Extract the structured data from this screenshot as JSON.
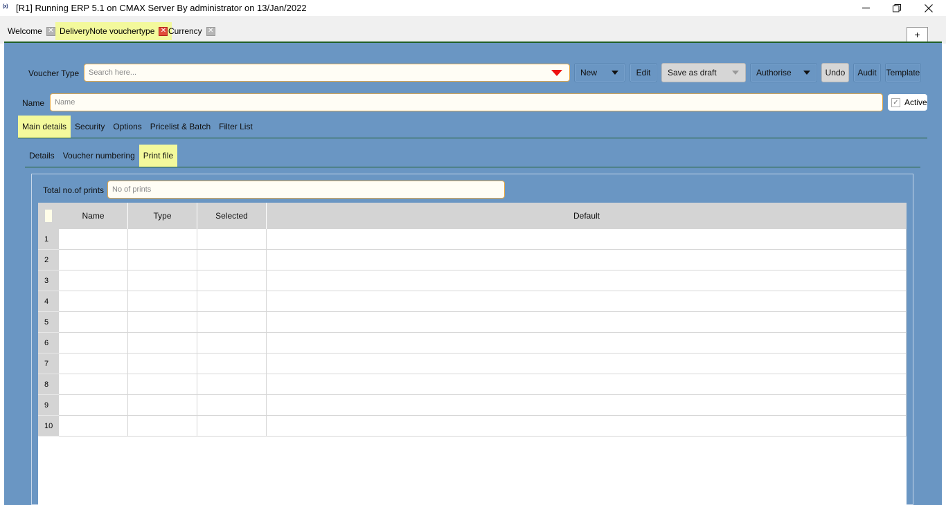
{
  "window": {
    "app_icon": "(x)",
    "title": "[R1] Running ERP 5.1 on CMAX Server By administrator on 13/Jan/2022"
  },
  "doc_tabs": [
    {
      "label": "Welcome",
      "active": false
    },
    {
      "label": "DeliveryNote vouchertype",
      "active": true
    },
    {
      "label": "Currency",
      "active": false
    }
  ],
  "add_tab_label": "+",
  "toolbar": {
    "voucher_type_label": "Voucher Type",
    "voucher_type_placeholder": "Search here...",
    "new_label": "New",
    "edit_label": "Edit",
    "save_draft_label": "Save as draft",
    "authorise_label": "Authorise",
    "undo_label": "Undo",
    "audit_label": "Audit",
    "template_label": "Template"
  },
  "name_row": {
    "label": "Name",
    "placeholder": "Name",
    "active_label": "Active"
  },
  "main_tabs": [
    "Main details",
    "Security",
    "Options",
    "Pricelist & Batch",
    "Filter List"
  ],
  "sub_tabs": [
    "Details",
    "Voucher numbering",
    "Print file"
  ],
  "prints": {
    "label": "Total no.of prints",
    "placeholder": "No of prints"
  },
  "table": {
    "columns": [
      "Name",
      "Type",
      "Selected",
      "Default"
    ],
    "rows": [
      "1",
      "2",
      "3",
      "4",
      "5",
      "6",
      "7",
      "8",
      "9",
      "10"
    ]
  },
  "colors": {
    "panel_bg": "#6a96c3",
    "active_tab": "#f3f99c",
    "accent_line": "#1f5e26",
    "dropdown_arrow": "#ee1111"
  }
}
